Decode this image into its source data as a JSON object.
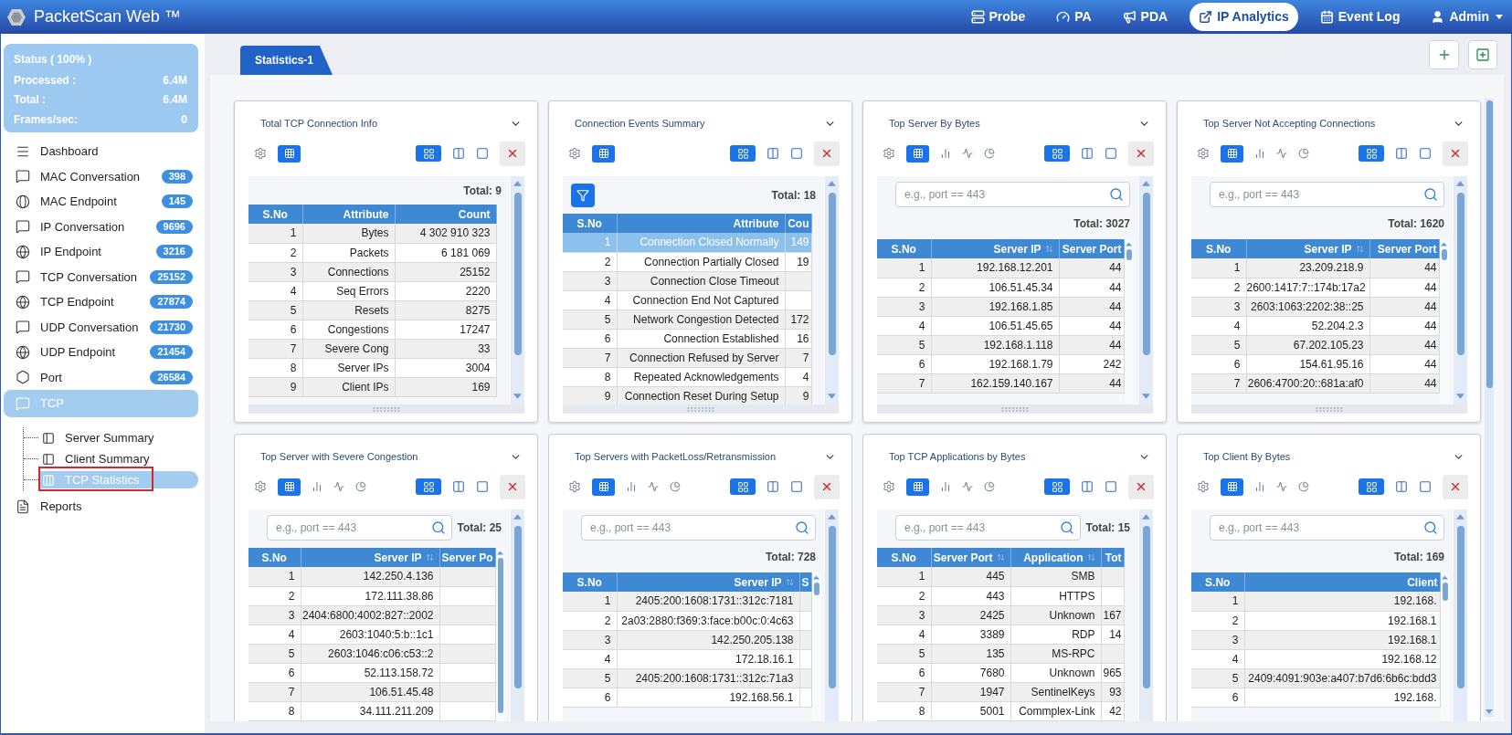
{
  "app": {
    "title": "PacketScan Web ™"
  },
  "nav": [
    {
      "label": "Probe",
      "selected": false,
      "dropdown": false
    },
    {
      "label": "PA",
      "selected": false,
      "dropdown": false
    },
    {
      "label": "PDA",
      "selected": false,
      "dropdown": false
    },
    {
      "label": "IP Analytics",
      "selected": true,
      "dropdown": false
    },
    {
      "label": "Event Log",
      "selected": false,
      "dropdown": false
    },
    {
      "label": "Admin",
      "selected": false,
      "dropdown": true
    }
  ],
  "status": {
    "title": "Status ( 100% )",
    "rows": [
      {
        "label": "Processed :",
        "value": "6.4M"
      },
      {
        "label": "Total :",
        "value": "6.4M"
      },
      {
        "label": "Frames/sec:",
        "value": "0"
      }
    ]
  },
  "sidebar": {
    "items": [
      {
        "label": "Dashboard",
        "selected": false
      },
      {
        "label": "MAC Conversation",
        "count": "398",
        "selected": false
      },
      {
        "label": "MAC Endpoint",
        "count": "145",
        "selected": false
      },
      {
        "label": "IP Conversation",
        "count": "9696",
        "selected": false
      },
      {
        "label": "IP Endpoint",
        "count": "3216",
        "selected": false
      },
      {
        "label": "TCP Conversation",
        "count": "25152",
        "selected": false
      },
      {
        "label": "TCP Endpoint",
        "count": "27874",
        "selected": false
      },
      {
        "label": "UDP Conversation",
        "count": "21730",
        "selected": false
      },
      {
        "label": "UDP Endpoint",
        "count": "21454",
        "selected": false
      },
      {
        "label": "Port",
        "count": "26584",
        "selected": false
      },
      {
        "label": "TCP",
        "selected": true,
        "expanded": true,
        "children": [
          {
            "label": "Server Summary",
            "selected": false,
            "marked": false
          },
          {
            "label": "Client Summary",
            "selected": false,
            "marked": false
          },
          {
            "label": "TCP Statistics",
            "selected": true,
            "marked": true
          }
        ]
      },
      {
        "label": "Reports",
        "selected": false
      }
    ]
  },
  "tabs": [
    {
      "label": "Statistics-1",
      "selected": true
    }
  ],
  "cards": [
    {
      "title": "Total TCP Connection Info",
      "views": [
        {
          "selected": true
        }
      ],
      "layouts": [
        {
          "selected": true
        },
        {
          "selected": false
        },
        {
          "selected": false
        }
      ],
      "total": "Total: 9",
      "columns": [
        {
          "label": "S.No",
          "sortable": false
        },
        {
          "label": "Attribute",
          "sortable": false
        },
        {
          "label": "Count",
          "sortable": false
        }
      ],
      "rows": [
        {
          "cells": [
            "1",
            "Bytes",
            "4 302 910 323"
          ],
          "selected": false
        },
        {
          "cells": [
            "2",
            "Packets",
            "6 181 069"
          ],
          "selected": false
        },
        {
          "cells": [
            "3",
            "Connections",
            "25152"
          ],
          "selected": false
        },
        {
          "cells": [
            "4",
            "Seq Errors",
            "2220"
          ],
          "selected": false
        },
        {
          "cells": [
            "5",
            "Resets",
            "8275"
          ],
          "selected": false
        },
        {
          "cells": [
            "6",
            "Congestions",
            "17247"
          ],
          "selected": false
        },
        {
          "cells": [
            "7",
            "Severe Cong",
            "33"
          ],
          "selected": false
        },
        {
          "cells": [
            "8",
            "Server IPs",
            "3004"
          ],
          "selected": false
        },
        {
          "cells": [
            "9",
            "Client IPs",
            "169"
          ],
          "selected": false
        }
      ]
    },
    {
      "title": "Connection Events Summary",
      "views": [
        {
          "selected": true
        }
      ],
      "layouts": [
        {
          "selected": true
        },
        {
          "selected": false
        },
        {
          "selected": false
        }
      ],
      "filter": {
        "kind": "button"
      },
      "total": "Total: 18",
      "columns": [
        {
          "label": "S.No",
          "sortable": false
        },
        {
          "label": "Attribute",
          "sortable": false
        },
        {
          "label": "Cou",
          "sortable": false
        }
      ],
      "rows": [
        {
          "cells": [
            "1",
            "Connection Closed Normally",
            "149"
          ],
          "selected": true
        },
        {
          "cells": [
            "2",
            "Connection Partially Closed",
            "19"
          ],
          "selected": false
        },
        {
          "cells": [
            "3",
            "Connection Close Timeout"
          ],
          "selected": false
        },
        {
          "cells": [
            "4",
            "Connection End Not Captured"
          ],
          "selected": false
        },
        {
          "cells": [
            "5",
            "Network Congestion Detected",
            "172"
          ],
          "selected": false
        },
        {
          "cells": [
            "6",
            "Connection Established",
            "16"
          ],
          "selected": false
        },
        {
          "cells": [
            "7",
            "Connection Refused by Server",
            "7"
          ],
          "selected": false
        },
        {
          "cells": [
            "8",
            "Repeated Acknowledgements",
            "4"
          ],
          "selected": false
        },
        {
          "cells": [
            "9",
            "Connection Reset During Setup",
            "9"
          ],
          "selected": false
        }
      ]
    },
    {
      "title": "Top Server By Bytes",
      "views": [
        {
          "selected": true
        },
        {
          "selected": false
        },
        {
          "selected": false
        },
        {
          "selected": false
        }
      ],
      "layouts": [
        {
          "selected": true
        },
        {
          "selected": false
        },
        {
          "selected": false
        }
      ],
      "filter": {
        "kind": "search",
        "placeholder": "e.g., port == 443",
        "inline": false
      },
      "total": "Total: 3027",
      "columns": [
        {
          "label": "S.No",
          "sortable": false
        },
        {
          "label": "Server IP",
          "sortable": true
        },
        {
          "label": "Server Port",
          "sortable": false
        }
      ],
      "rows": [
        {
          "cells": [
            "1",
            "192.168.12.201",
            "44"
          ],
          "selected": false
        },
        {
          "cells": [
            "2",
            "106.51.45.34",
            "44"
          ],
          "selected": false
        },
        {
          "cells": [
            "3",
            "192.168.1.85",
            "44"
          ],
          "selected": false
        },
        {
          "cells": [
            "4",
            "106.51.45.65",
            "44"
          ],
          "selected": false
        },
        {
          "cells": [
            "5",
            "192.168.1.118",
            "44"
          ],
          "selected": false
        },
        {
          "cells": [
            "6",
            "192.168.1.79",
            "242"
          ],
          "selected": false
        },
        {
          "cells": [
            "7",
            "162.159.140.167",
            "44"
          ],
          "selected": false
        }
      ]
    },
    {
      "title": "Top Server Not Accepting Connections",
      "views": [
        {
          "selected": true
        },
        {
          "selected": false
        },
        {
          "selected": false
        },
        {
          "selected": false
        }
      ],
      "layouts": [
        {
          "selected": true
        },
        {
          "selected": false
        },
        {
          "selected": false
        }
      ],
      "filter": {
        "kind": "search",
        "placeholder": "e.g., port == 443",
        "inline": false
      },
      "total": "Total: 1620",
      "columns": [
        {
          "label": "S.No",
          "sortable": false
        },
        {
          "label": "Server IP",
          "sortable": true
        },
        {
          "label": "Server Port",
          "sortable": false
        }
      ],
      "rows": [
        {
          "cells": [
            "1",
            "23.209.218.9",
            "44"
          ],
          "selected": false
        },
        {
          "cells": [
            "2",
            "2600:1417:7::174b:17a2",
            "44"
          ],
          "selected": false
        },
        {
          "cells": [
            "3",
            "2603:1063:2202:38::25",
            "44"
          ],
          "selected": false
        },
        {
          "cells": [
            "4",
            "52.204.2.3",
            "44"
          ],
          "selected": false
        },
        {
          "cells": [
            "5",
            "67.202.105.23",
            "44"
          ],
          "selected": false
        },
        {
          "cells": [
            "6",
            "154.61.95.16",
            "44"
          ],
          "selected": false
        },
        {
          "cells": [
            "7",
            "2606:4700:20::681a:af0",
            "44"
          ],
          "selected": false
        }
      ]
    },
    {
      "title": "Top Server with Severe Congestion",
      "views": [
        {
          "selected": true
        },
        {
          "selected": false
        },
        {
          "selected": false
        },
        {
          "selected": false
        }
      ],
      "layouts": [
        {
          "selected": true
        },
        {
          "selected": false
        },
        {
          "selected": false
        }
      ],
      "filter": {
        "kind": "search",
        "placeholder": "e.g., port == 443",
        "inline": true
      },
      "total": "Total: 25",
      "columns": [
        {
          "label": "S.No",
          "sortable": false
        },
        {
          "label": "Server IP",
          "sortable": true
        },
        {
          "label": "Server Po",
          "sortable": false
        }
      ],
      "rows": [
        {
          "cells": [
            "1",
            "142.250.4.136"
          ],
          "selected": false
        },
        {
          "cells": [
            "2",
            "172.111.38.86"
          ],
          "selected": false
        },
        {
          "cells": [
            "3",
            "2404:6800:4002:827::2002"
          ],
          "selected": false
        },
        {
          "cells": [
            "4",
            "2603:1040:5:b::1c1"
          ],
          "selected": false
        },
        {
          "cells": [
            "5",
            "2603:1046:c06:c53::2"
          ],
          "selected": false
        },
        {
          "cells": [
            "6",
            "52.113.158.72"
          ],
          "selected": false
        },
        {
          "cells": [
            "7",
            "106.51.45.48"
          ],
          "selected": false
        },
        {
          "cells": [
            "8",
            "34.111.211.209"
          ],
          "selected": false
        }
      ]
    },
    {
      "title": "Top Servers with PacketLoss/Retransmission",
      "views": [
        {
          "selected": true
        },
        {
          "selected": false
        },
        {
          "selected": false
        },
        {
          "selected": false
        }
      ],
      "layouts": [
        {
          "selected": true
        },
        {
          "selected": false
        },
        {
          "selected": false
        }
      ],
      "filter": {
        "kind": "search",
        "placeholder": "e.g., port == 443",
        "inline": false
      },
      "total": "Total: 728",
      "columns": [
        {
          "label": "S.No",
          "sortable": false
        },
        {
          "label": "Server IP",
          "sortable": true
        },
        {
          "label": "S",
          "sortable": false
        }
      ],
      "rows": [
        {
          "cells": [
            "1",
            "2405:200:1608:1731::312c:7181"
          ],
          "selected": false
        },
        {
          "cells": [
            "2",
            "2a03:2880:f369:3:face:b00c:0:4c63"
          ],
          "selected": false
        },
        {
          "cells": [
            "3",
            "142.250.205.138"
          ],
          "selected": false
        },
        {
          "cells": [
            "4",
            "172.18.16.1"
          ],
          "selected": false
        },
        {
          "cells": [
            "5",
            "2405:200:1608:1731::312c:71a3"
          ],
          "selected": false
        },
        {
          "cells": [
            "6",
            "192.168.56.1"
          ],
          "selected": false
        }
      ]
    },
    {
      "title": "Top TCP Applications by Bytes",
      "views": [
        {
          "selected": true
        },
        {
          "selected": false
        },
        {
          "selected": false
        },
        {
          "selected": false
        }
      ],
      "layouts": [
        {
          "selected": true
        },
        {
          "selected": false
        },
        {
          "selected": false
        }
      ],
      "filter": {
        "kind": "search",
        "placeholder": "e.g., port == 443",
        "inline": true
      },
      "total": "Total: 15",
      "columns": [
        {
          "label": "S.No",
          "sortable": false
        },
        {
          "label": "Server Port",
          "sortable": true
        },
        {
          "label": "Application",
          "sortable": true
        },
        {
          "label": "Tot",
          "sortable": false
        }
      ],
      "rows": [
        {
          "cells": [
            "1",
            "445",
            "SMB"
          ],
          "selected": false
        },
        {
          "cells": [
            "2",
            "443",
            "HTTPS"
          ],
          "selected": false
        },
        {
          "cells": [
            "3",
            "2425",
            "Unknown",
            "167"
          ],
          "selected": false
        },
        {
          "cells": [
            "4",
            "3389",
            "RDP",
            "14"
          ],
          "selected": false
        },
        {
          "cells": [
            "5",
            "135",
            "MS-RPC"
          ],
          "selected": false
        },
        {
          "cells": [
            "6",
            "7680",
            "Unknown",
            "965"
          ],
          "selected": false
        },
        {
          "cells": [
            "7",
            "1947",
            "SentinelKeys",
            "93"
          ],
          "selected": false
        },
        {
          "cells": [
            "8",
            "5001",
            "Commplex-Link",
            "42"
          ],
          "selected": false
        }
      ]
    },
    {
      "title": "Top Client By Bytes",
      "views": [
        {
          "selected": true
        },
        {
          "selected": false
        },
        {
          "selected": false
        },
        {
          "selected": false
        }
      ],
      "layouts": [
        {
          "selected": true
        },
        {
          "selected": false
        },
        {
          "selected": false
        }
      ],
      "filter": {
        "kind": "search",
        "placeholder": "e.g., port == 443",
        "inline": false
      },
      "total": "Total: 169",
      "columns": [
        {
          "label": "S.No",
          "sortable": false
        },
        {
          "label": "Client",
          "sortable": false
        }
      ],
      "rows": [
        {
          "cells": [
            "1",
            "192.168."
          ],
          "selected": false
        },
        {
          "cells": [
            "2",
            "192.168.1"
          ],
          "selected": false
        },
        {
          "cells": [
            "3",
            "192.168.1"
          ],
          "selected": false
        },
        {
          "cells": [
            "4",
            "192.168.12"
          ],
          "selected": false
        },
        {
          "cells": [
            "5",
            "2409:4091:903e:a407:b7d6:6b6c:bdd3"
          ],
          "selected": false
        },
        {
          "cells": [
            "6",
            "192.168."
          ],
          "selected": false
        }
      ]
    }
  ]
}
